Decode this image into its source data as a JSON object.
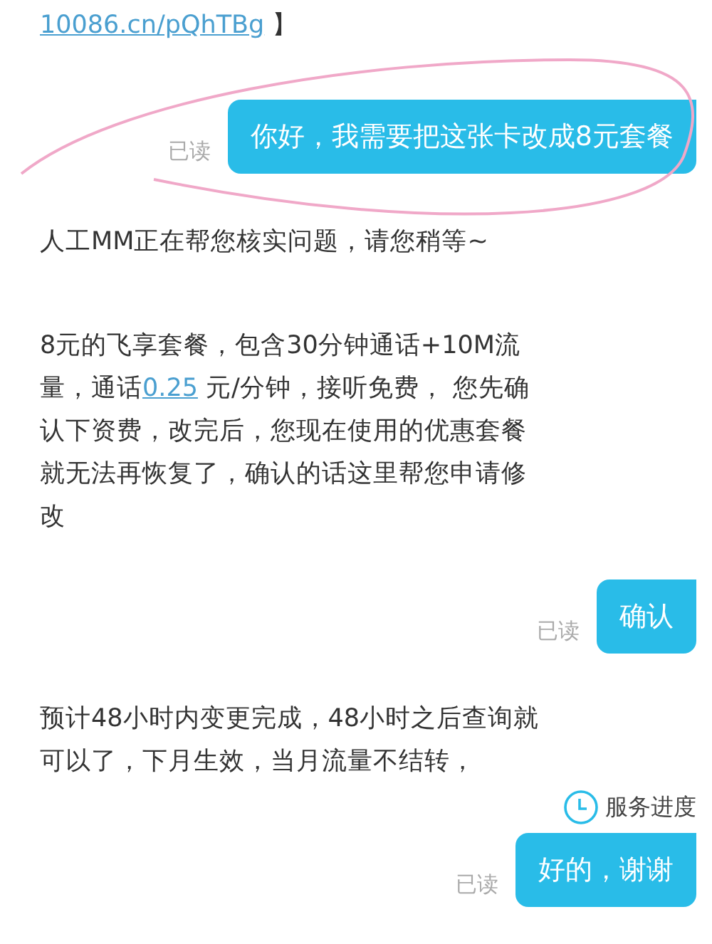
{
  "messages": [
    {
      "kind": "agent",
      "segments": [
        {
          "kind": "link",
          "text": "10086.cn/pQhTBg"
        },
        {
          "kind": "text",
          "text": " 】"
        }
      ]
    },
    {
      "kind": "user",
      "text": "你好，我需要把这张卡改成8元套餐",
      "status": "已读",
      "circled": true
    },
    {
      "kind": "agent",
      "segments": [
        {
          "kind": "text",
          "text": "人工MM正在帮您核实问题，请您稍等~"
        }
      ]
    },
    {
      "kind": "agent",
      "segments": [
        {
          "kind": "text",
          "text": "8元的飞享套餐，包含30分钟通话+10M流量，通话"
        },
        {
          "kind": "link",
          "text": "0.25"
        },
        {
          "kind": "text",
          "text": " 元/分钟，接听免费， 您先确认下资费，改完后，您现在使用的优惠套餐就无法再恢复了，确认的话这里帮您申请修改"
        }
      ]
    },
    {
      "kind": "user",
      "text": "确认",
      "status": "已读",
      "circled": false
    },
    {
      "kind": "agent",
      "segments": [
        {
          "kind": "text",
          "text": "预计48小时内变更完成，48小时之后查询就可以了，下月生效，当月流量不结转，"
        }
      ]
    },
    {
      "kind": "progress",
      "text": "服务进度"
    },
    {
      "kind": "user",
      "text": "好的，谢谢",
      "status": "已读",
      "circled": false
    }
  ]
}
